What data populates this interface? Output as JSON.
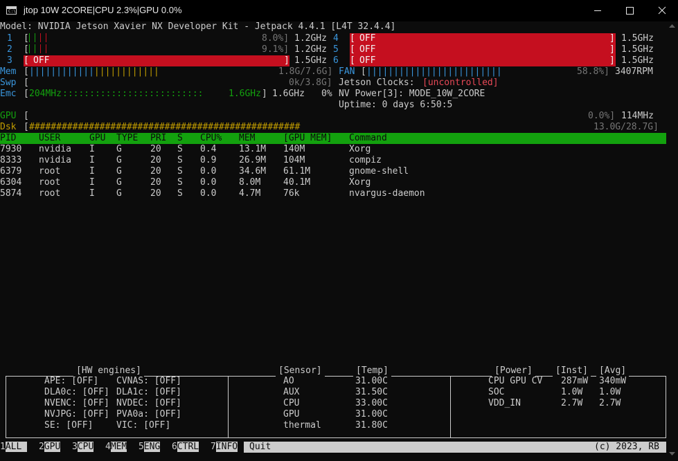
{
  "window": {
    "title": "jtop 10W 2CORE|CPU 2.3%|GPU 0.0%",
    "icon": "console-icon"
  },
  "header": {
    "model_line": "Model: NVIDIA Jetson Xavier NX Developer Kit - Jetpack 4.4.1 [L4T 32.4.4]"
  },
  "cpus": [
    {
      "num": "1",
      "pct": "8.0%]",
      "freq": "1.2GHz"
    },
    {
      "num": "2",
      "pct": "9.1%]",
      "freq": "1.2GHz"
    },
    {
      "num": "3",
      "off": "OFF",
      "freq": "1.5GHz"
    },
    {
      "num": "4",
      "off": "OFF",
      "freq": "1.5GHz"
    },
    {
      "num": "5",
      "off": "OFF",
      "freq": "1.5GHz"
    },
    {
      "num": "6",
      "off": "OFF",
      "freq": "1.5GHz"
    }
  ],
  "mem": {
    "label": "Mem",
    "bar": "||||||||||||||||||||||||||||||||",
    "value": "1.8G/7.6G]"
  },
  "swp": {
    "label": "Swp",
    "value": "0k/3.8G]"
  },
  "emc": {
    "label": "Emc",
    "bar_start": "204MHz",
    "bar_mid": "::::::::::::::::::::::::::",
    "bar_end": "1.6GHz",
    "freq": "1.6GHz",
    "pct": "0%"
  },
  "fan": {
    "label": "FAN",
    "bar": "|||||||||||||||||||||||||||||||||",
    "pct": "58.8%]",
    "rpm": "3407RPM"
  },
  "clocks": {
    "label": "Jetson Clocks:",
    "value": "[uncontrolled]"
  },
  "nvpower": {
    "text": "NV Power[3]: MODE_10W_2CORE"
  },
  "uptime": {
    "text": "Uptime: 0 days 6:50:5"
  },
  "gpu": {
    "label": "GPU",
    "pct": "0.0%]",
    "freq": "114MHz"
  },
  "dsk": {
    "label": "Dsk",
    "bar": "##################################################",
    "value": "13.0G/28.7G]"
  },
  "proc_headers": [
    "PID",
    "USER",
    "GPU",
    "TYPE",
    "PRI",
    "S",
    "CPU%",
    "MEM",
    "[GPU MEM]",
    "Command"
  ],
  "processes": [
    [
      "7930",
      "nvidia",
      "I",
      "G",
      "20",
      "S",
      "0.4",
      "13.1M",
      "140M",
      "Xorg"
    ],
    [
      "8333",
      "nvidia",
      "I",
      "G",
      "20",
      "S",
      "0.9",
      "26.9M",
      "104M",
      "compiz"
    ],
    [
      "6379",
      "root",
      "I",
      "G",
      "20",
      "S",
      "0.0",
      "34.6M",
      "61.1M",
      "gnome-shell"
    ],
    [
      "6304",
      "root",
      "I",
      "G",
      "20",
      "S",
      "0.0",
      "8.0M",
      "40.1M",
      "Xorg"
    ],
    [
      "5874",
      "root",
      "I",
      "G",
      "20",
      "S",
      "0.0",
      "4.7M",
      "76k",
      "nvargus-daemon"
    ]
  ],
  "hw": {
    "title": "[HW engines]",
    "rows": [
      [
        "APE: [OFF]",
        "CVNAS: [OFF]"
      ],
      [
        "DLA0c: [OFF]",
        "DLA1c: [OFF]"
      ],
      [
        "NVENC: [OFF]",
        "NVDEC: [OFF]"
      ],
      [
        "NVJPG: [OFF]",
        "PVA0a: [OFF]"
      ],
      [
        "SE: [OFF]",
        "VIC: [OFF]"
      ]
    ]
  },
  "sensor": {
    "title_sensor": "[Sensor]",
    "title_temp": "[Temp]",
    "rows": [
      [
        "AO",
        "31.00C"
      ],
      [
        "AUX",
        "31.50C"
      ],
      [
        "CPU",
        "33.00C"
      ],
      [
        "GPU",
        "31.00C"
      ],
      [
        "thermal",
        "31.80C"
      ]
    ]
  },
  "power": {
    "title_power": "[Power]",
    "title_inst": "[Inst]",
    "title_avg": "[Avg]",
    "rows": [
      [
        "CPU GPU CV",
        "287mW",
        "340mW"
      ],
      [
        "SOC",
        "1.0W",
        "1.0W"
      ],
      [
        "VDD_IN",
        "2.7W",
        "2.7W"
      ]
    ]
  },
  "footer": {
    "tabs": [
      {
        "key": "1",
        "label": "ALL"
      },
      {
        "key": "2",
        "label": "GPU"
      },
      {
        "key": "3",
        "label": "CPU"
      },
      {
        "key": "4",
        "label": "MEM"
      },
      {
        "key": "5",
        "label": "ENG"
      },
      {
        "key": "6",
        "label": "CTRL"
      },
      {
        "key": "7",
        "label": "INFO"
      }
    ],
    "quit": "Quit",
    "copyright": "(c) 2023, RB"
  },
  "colors": {
    "bg": "#0c0c0c",
    "fg": "#cccccc",
    "cyan": "#3a96dd",
    "green": "#13a10e",
    "yellow": "#c19c00",
    "red": "#c50f1f"
  }
}
